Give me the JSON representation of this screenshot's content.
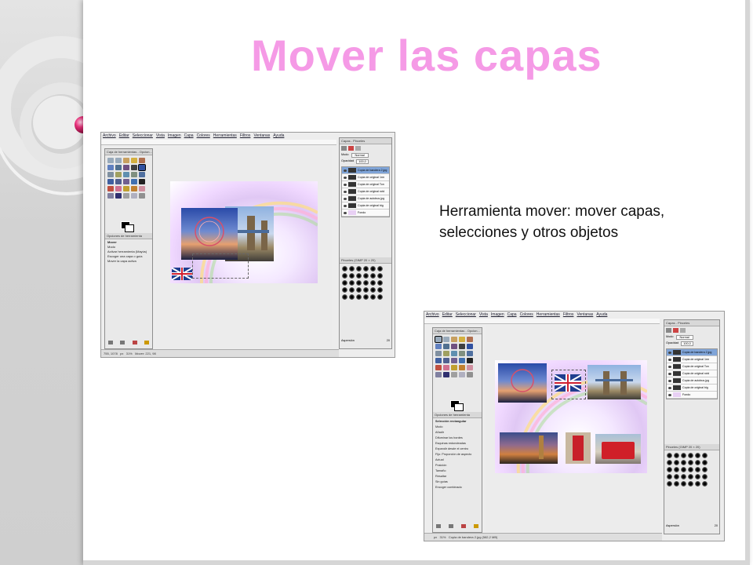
{
  "slide": {
    "title": "Mover las capas",
    "description": "Herramienta mover: mover capas, selecciones y otros objetos"
  },
  "colors": {
    "title": "#f59ae6",
    "accent_ball": "#e8307a",
    "left_band": "#d4d4d4"
  },
  "gimp": {
    "menu": [
      "Archivo",
      "Editar",
      "Seleccionar",
      "Vista",
      "Imagen",
      "Capa",
      "Colores",
      "Herramientas",
      "Filtros",
      "Ventanas",
      "Ayuda"
    ],
    "toolbox_title": "Caja de herramientas - Opcion...",
    "layers_title": "Capas - Pinceles",
    "screenshot1": {
      "tool_options_title": "Opciones de herramienta",
      "tool_name": "Mover",
      "mode_label": "Modo",
      "option_lines": [
        "Activar herramienta (Mayús)",
        "Escoger una capa o guía",
        "Mover la capa activa"
      ],
      "mode_value": "Normal",
      "opacity_label": "Opacidad",
      "opacity_value": "100,0",
      "layers": [
        "Copia de bandera 2.jpg",
        "Copia de original 1rm",
        "Copia de original Ton",
        "Copia de original rotd",
        "Copia de autobus.jpg",
        "Copia de original big",
        "Fondo"
      ],
      "brushes_title": "Pinceles (GIMP 20 × 20)",
      "brush_name": "Aspersión",
      "brush_value": "20",
      "status_left": "755, 1078",
      "status_unit": "px",
      "status_zoom": "31%",
      "status_text": "Mover: 221, 98"
    },
    "screenshot2": {
      "tool_options_title": "Opciones de herramienta",
      "tool_name": "Selección rectangular",
      "mode_label": "Modo",
      "option_lines": [
        "Añadir",
        "Difuminar los bordes",
        "Esquinas redondeadas",
        "Expandir desde el centro",
        "Fijo: Proporción de aspecto",
        "Actual",
        "Posición",
        "Tamaño",
        "Resaltar",
        "Sin guías",
        "Encoger combinado"
      ],
      "mode_value": "Normal",
      "opacity_label": "Opacidad",
      "opacity_value": "100,0",
      "layers": [
        "Copia de bandera 2.jpg",
        "Copia de original 1rm",
        "Copia de original Ton",
        "Copia de original rotd",
        "Copia de autobus.jpg",
        "Copia de original big",
        "Fondo"
      ],
      "brushes_title": "Pinceles (GIMP 20 × 20)",
      "brush_name": "Aspersión",
      "brush_value": "20",
      "status_unit": "px",
      "status_zoom": "31%",
      "status_text": "Copia de bandera 2.jpg (582,2 MB)"
    }
  }
}
